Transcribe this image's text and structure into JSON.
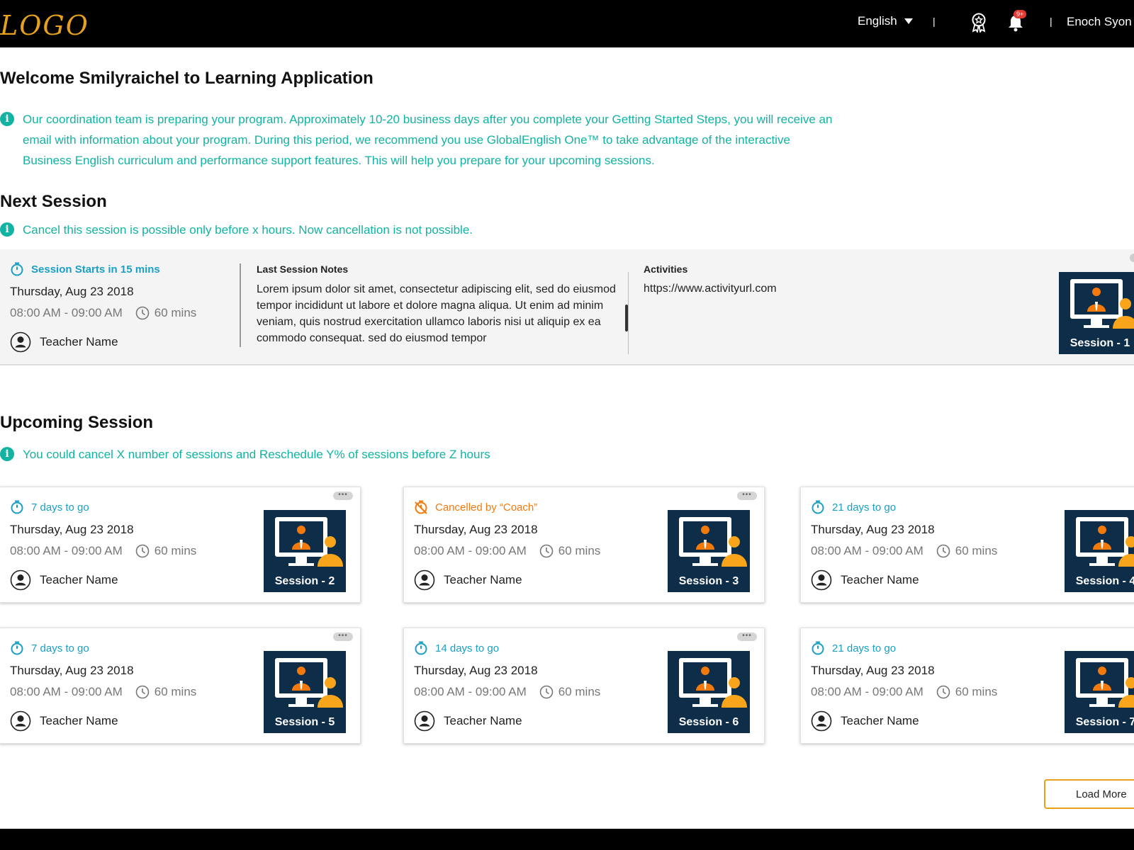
{
  "header": {
    "logo": "LOGO",
    "language": "English",
    "notification_badge": "9+",
    "user_name": "Enoch Syon"
  },
  "welcome": {
    "title": "Welcome Smilyraichel to Learning Application",
    "info_lines": [
      "Our coordination team is preparing your program. Approximately 10-20 business days after you complete your Getting Started Steps, you will receive an",
      "email with information about your program. During this period, we recommend you use GlobalEnglish One™ to take advantage of the interactive",
      "Business English curriculum and performance support features. This will help you prepare for your upcoming sessions."
    ]
  },
  "next_session": {
    "title": "Next Session",
    "info": "Cancel this session is possible only before x hours. Now cancellation is not possible.",
    "status": "Session Starts in 15 mins",
    "date": "Thursday, Aug 23 2018",
    "time": "08:00 AM - 09:00 AM",
    "duration": "60 mins",
    "teacher": "Teacher Name",
    "notes_label": "Last Session Notes",
    "notes": "Lorem ipsum dolor sit amet, consectetur  adipiscing elit, sed do eiusmod tempor incididunt ut labore et dolore magna aliqua. Ut enim ad minim veniam, quis nostrud exercitation ullamco laboris nisi ut aliquip ex ea commodo consequat. sed do eiusmod tempor",
    "activities_label": "Activities",
    "activities_url": "https://www.activityurl.com",
    "session_label": "Session - 1"
  },
  "upcoming": {
    "title": "Upcoming Session",
    "info": "You could cancel X number of sessions and Reschedule Y% of sessions before Z hours",
    "more_icon": "ellipsis-icon",
    "cards": [
      {
        "status": "7 days to go",
        "cancelled": false,
        "date": "Thursday, Aug 23 2018",
        "time": "08:00 AM - 09:00 AM",
        "duration": "60 mins",
        "teacher": "Teacher Name",
        "session_label": "Session - 2"
      },
      {
        "status": "Cancelled by “Coach”",
        "cancelled": true,
        "date": "Thursday, Aug 23 2018",
        "time": "08:00 AM - 09:00 AM",
        "duration": "60 mins",
        "teacher": "Teacher Name",
        "session_label": "Session - 3"
      },
      {
        "status": "21 days to go",
        "cancelled": false,
        "date": "Thursday, Aug 23 2018",
        "time": "08:00 AM - 09:00 AM",
        "duration": "60 mins",
        "teacher": "Teacher Name",
        "session_label": "Session - 4"
      },
      {
        "status": "7 days to go",
        "cancelled": false,
        "date": "Thursday, Aug 23 2018",
        "time": "08:00 AM - 09:00 AM",
        "duration": "60 mins",
        "teacher": "Teacher Name",
        "session_label": "Session - 5"
      },
      {
        "status": "14 days to go",
        "cancelled": false,
        "date": "Thursday, Aug 23 2018",
        "time": "08:00 AM - 09:00 AM",
        "duration": "60 mins",
        "teacher": "Teacher Name",
        "session_label": "Session - 6"
      },
      {
        "status": "21 days to go",
        "cancelled": false,
        "date": "Thursday, Aug 23 2018",
        "time": "08:00 AM - 09:00 AM",
        "duration": "60 mins",
        "teacher": "Teacher Name",
        "session_label": "Session - 7"
      }
    ],
    "load_more": "Load More"
  },
  "colors": {
    "accent_teal": "#12b3a2",
    "status_blue": "#1a9fc5",
    "cancel_orange": "#f27a0d",
    "brand_gold": "#e7a11d",
    "thumb_navy": "#0d2d48"
  }
}
